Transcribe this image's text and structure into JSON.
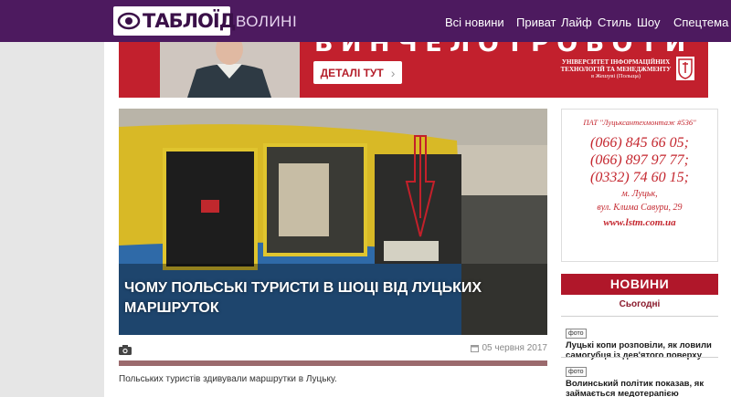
{
  "header": {
    "logo_text": "ТАБЛОЇД",
    "logo_sub": "ВОЛИНІ",
    "nav": [
      "Всі новини",
      "Приват",
      "Лайф",
      "Стиль",
      "Шоу",
      "Спецтема"
    ]
  },
  "banner": {
    "button_label": "ДЕТАЛІ ТУТ",
    "button_arrow": "›",
    "university_line1": "УНІВЕРСИТЕТ ІНФОРМАЦІЙНИХ",
    "university_line2": "ТЕХНОЛОГІЙ ТА МЕНЕДЖМЕНТУ",
    "university_line3": "в Жешуві (Польща)"
  },
  "article": {
    "title": "Чому польські туристи в шоці від луцьких маршруток",
    "date": "05 червня 2017",
    "excerpt": "Польських туристів здивували маршрутки в Луцьку."
  },
  "side_ad": {
    "company": "ПАТ \"Луцьксантехмонтаж #536\"",
    "phones": [
      "(066) 845 66 05;",
      "(066) 897 97 77;",
      "(0332) 74 60 15;"
    ],
    "city": "м. Луцьк,",
    "street": "вул. Клима Савури, 29",
    "site": "www.lstm.com.ua"
  },
  "news": {
    "header": "НОВИНИ",
    "today_label": "Сьогодні",
    "photo_tag": "фото",
    "items": [
      {
        "title": "Луцькі копи розповіли, як ловили самогубця із дев'ятого поверху"
      },
      {
        "title": "Волинський політик показав, як займається медотерапією"
      }
    ]
  },
  "colors": {
    "header_bg": "#4d1a5f",
    "banner_red": "#c2202d",
    "news_header": "#b0172a",
    "divider": "#9b6a6d"
  }
}
